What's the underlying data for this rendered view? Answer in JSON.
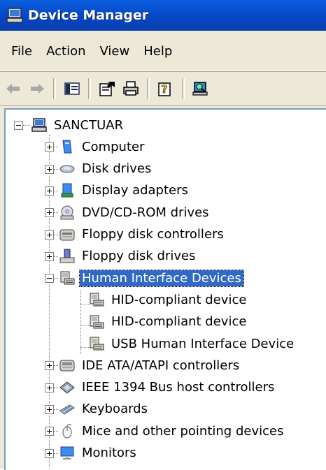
{
  "window": {
    "title": "Device Manager"
  },
  "menu": [
    "File",
    "Action",
    "View",
    "Help"
  ],
  "toolbar": {
    "buttons": [
      "back-arrow-icon",
      "forward-arrow-icon",
      "show-hide-console-tree-icon",
      "properties-icon",
      "print-icon",
      "help-icon",
      "scan-hardware-icon"
    ]
  },
  "tree": {
    "root": "SANCTUAR",
    "categories": [
      {
        "label": "Computer",
        "icon": "computer-icon",
        "expanded": false
      },
      {
        "label": "Disk drives",
        "icon": "disk-drive-icon",
        "expanded": false
      },
      {
        "label": "Display adapters",
        "icon": "display-adapter-icon",
        "expanded": false
      },
      {
        "label": "DVD/CD-ROM drives",
        "icon": "dvd-drive-icon",
        "expanded": false
      },
      {
        "label": "Floppy disk controllers",
        "icon": "floppy-controller-icon",
        "expanded": false
      },
      {
        "label": "Floppy disk drives",
        "icon": "floppy-drive-icon",
        "expanded": false
      },
      {
        "label": "Human Interface Devices",
        "icon": "hid-icon",
        "expanded": true,
        "selected": true,
        "children": [
          "HID-compliant device",
          "HID-compliant device",
          "USB Human Interface Device"
        ]
      },
      {
        "label": "IDE ATA/ATAPI controllers",
        "icon": "ide-controller-icon",
        "expanded": false
      },
      {
        "label": "IEEE 1394 Bus host controllers",
        "icon": "ieee1394-icon",
        "expanded": false
      },
      {
        "label": "Keyboards",
        "icon": "keyboard-icon",
        "expanded": false
      },
      {
        "label": "Mice and other pointing devices",
        "icon": "mouse-icon",
        "expanded": false
      },
      {
        "label": "Monitors",
        "icon": "monitor-icon",
        "expanded": false
      }
    ]
  }
}
